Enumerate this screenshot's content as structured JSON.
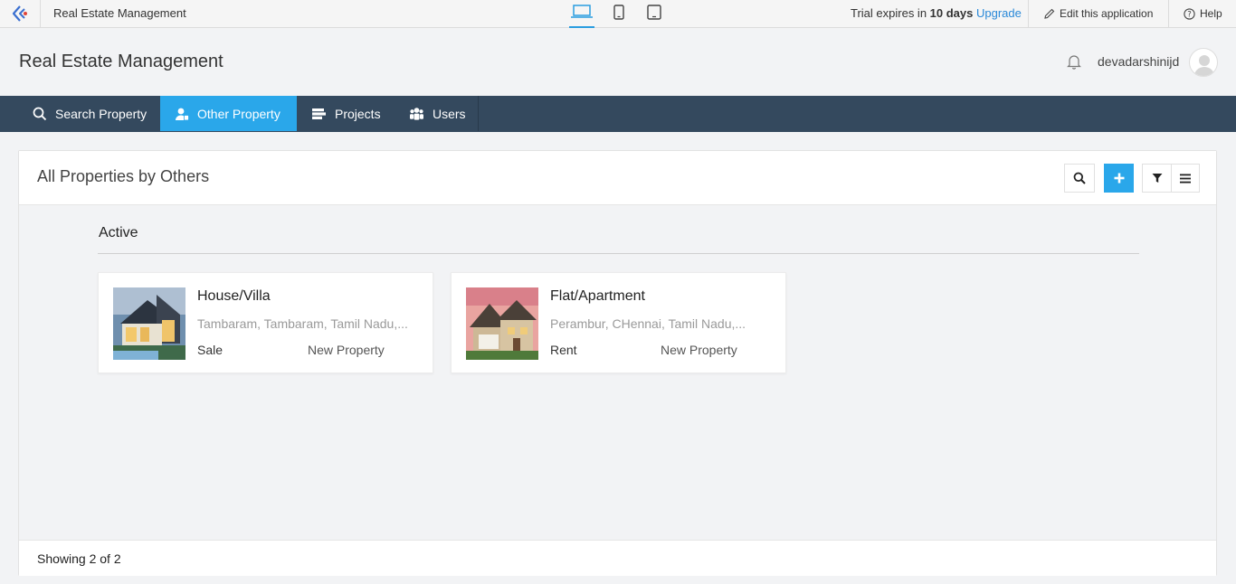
{
  "topbar": {
    "app_crumb": "Real Estate Management",
    "trial_prefix": "Trial expires in ",
    "trial_days": "10 days",
    "upgrade": "Upgrade",
    "edit_app": "Edit this application",
    "help": "Help"
  },
  "header": {
    "title": "Real Estate Management",
    "username": "devadarshinijd"
  },
  "nav": {
    "items": [
      {
        "label": "Search Property",
        "icon": "search-icon"
      },
      {
        "label": "Other Property",
        "icon": "user-icon"
      },
      {
        "label": "Projects",
        "icon": "projects-icon"
      },
      {
        "label": "Users",
        "icon": "users-icon"
      }
    ],
    "active_index": 1
  },
  "panel": {
    "title": "All Properties by Others",
    "group": "Active",
    "cards": [
      {
        "title": "House/Villa",
        "address": "Tambaram, Tambaram, Tamil Nadu,...",
        "type": "Sale",
        "status": "New Property"
      },
      {
        "title": "Flat/Apartment",
        "address": "Perambur, CHennai, Tamil Nadu,...",
        "type": "Rent",
        "status": "New Property"
      }
    ],
    "footer": "Showing 2 of 2"
  },
  "colors": {
    "accent": "#2aa7ea",
    "nav_bg": "#34495e",
    "link": "#2a89d8"
  }
}
